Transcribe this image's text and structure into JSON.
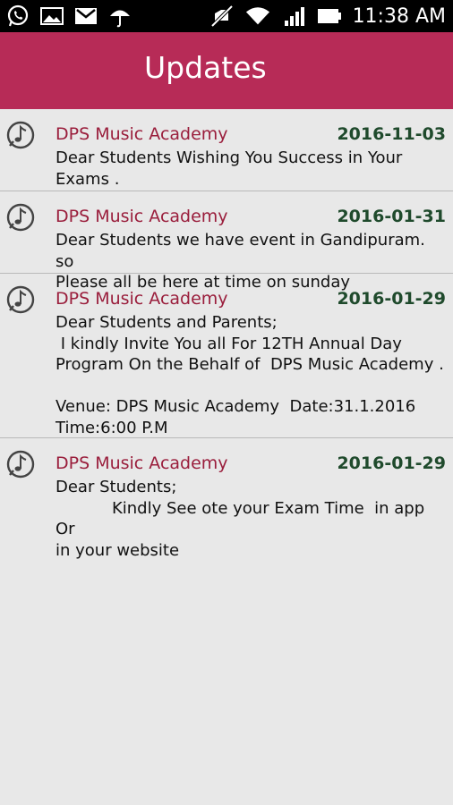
{
  "status_bar": {
    "time": "11:38 AM",
    "icons": [
      "whatsapp-icon",
      "gallery-icon",
      "gmail-icon",
      "weather-icon",
      "mute-icon",
      "wifi-icon",
      "signal-icon",
      "battery-icon"
    ]
  },
  "app_bar": {
    "title": "Updates",
    "color": "#b72b57"
  },
  "updates": [
    {
      "sender": "DPS Music Academy",
      "date": "2016-11-03",
      "message": "Dear Students Wishing You Success in Your\nExams ."
    },
    {
      "sender": "DPS Music Academy",
      "date": "2016-01-31",
      "message": "Dear Students we have event in Gandipuram. so\nPlease all be here at time on sunday"
    },
    {
      "sender": "DPS Music Academy",
      "date": "2016-01-29",
      "message": "Dear Students and Parents;\n I kindly Invite You all For 12TH Annual Day\nProgram On the Behalf of  DPS Music Academy .\n\nVenue: DPS Music Academy  Date:31.1.2016\nTime:6:00 P.M"
    },
    {
      "sender": "DPS Music Academy",
      "date": "2016-01-29",
      "message": "Dear Students;\n           Kindly See ote your Exam Time  in app Or\nin your website"
    }
  ]
}
